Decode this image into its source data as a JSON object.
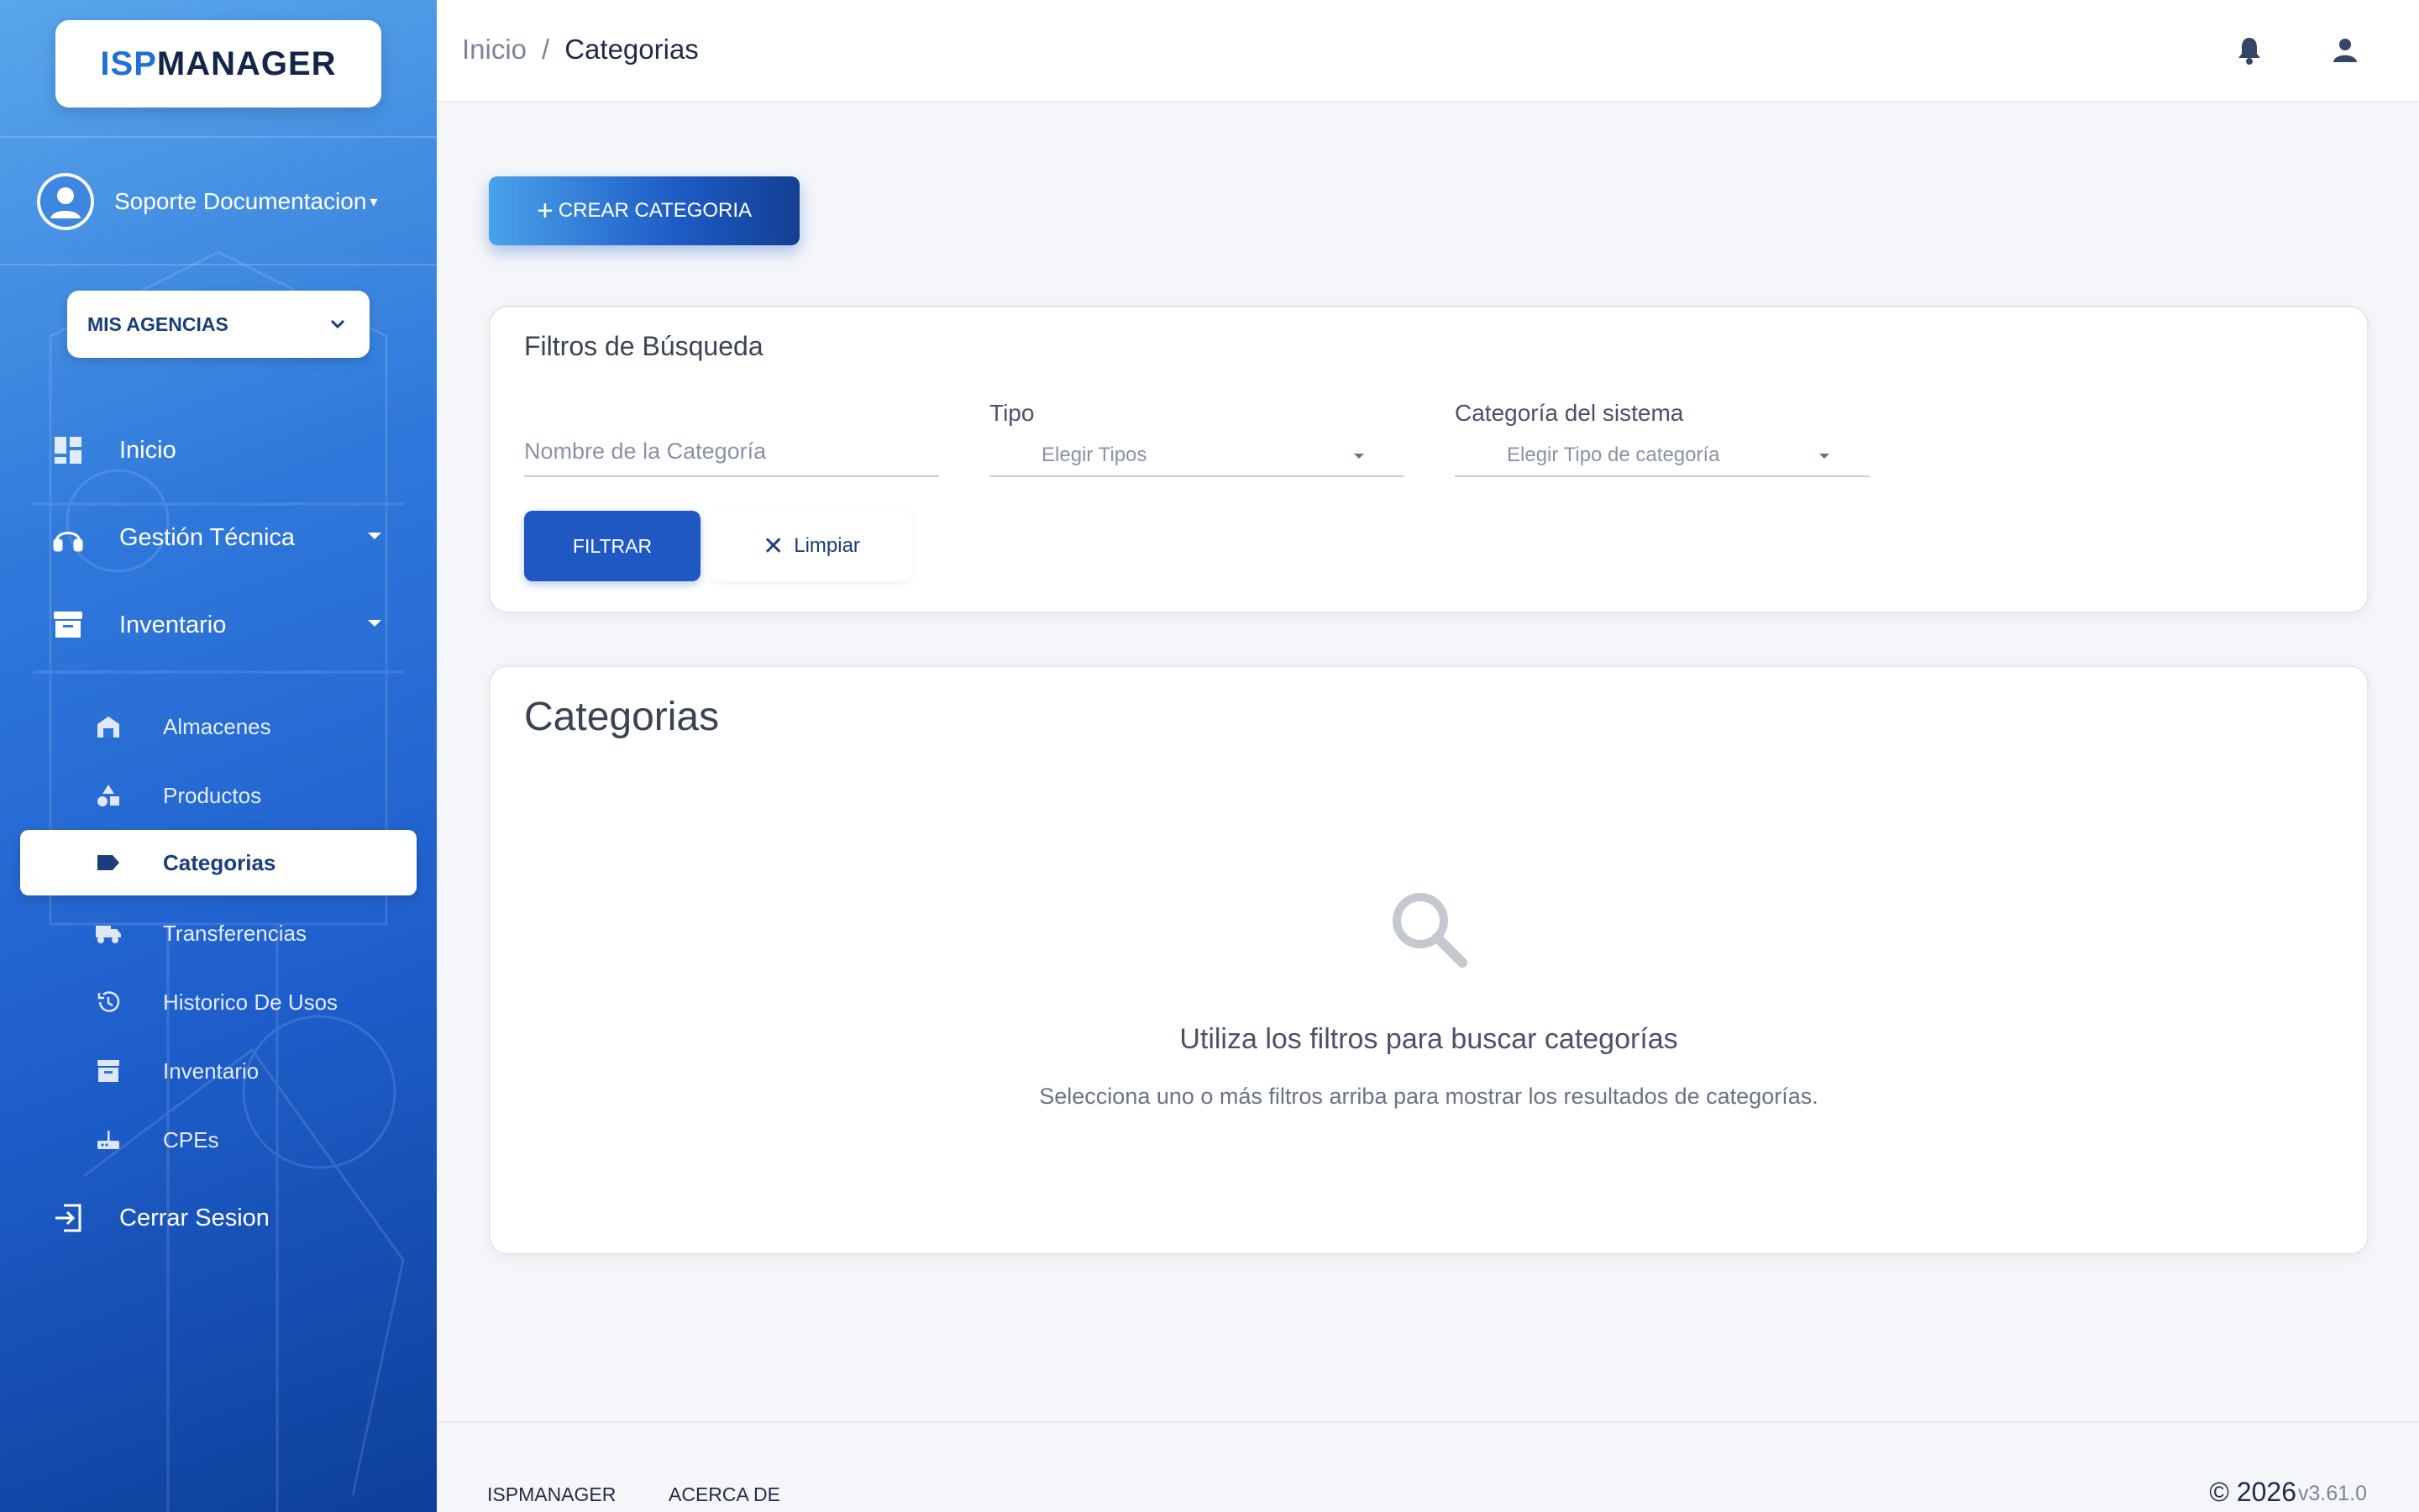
{
  "app": {
    "logo_part1": "ISP",
    "logo_part2": "MANAGER"
  },
  "sidebar": {
    "user_name": "Soporte Documentacion",
    "agency_label": "MIS AGENCIAS",
    "nav": [
      {
        "label": "Inicio",
        "icon": "dashboard-icon"
      },
      {
        "label": "Gestión Técnica",
        "icon": "headset-icon"
      },
      {
        "label": "Inventario",
        "icon": "archive-icon"
      }
    ],
    "sub_items": [
      {
        "label": "Almacenes",
        "icon": "warehouse-icon"
      },
      {
        "label": "Productos",
        "icon": "shapes-icon"
      },
      {
        "label": "Categorias",
        "icon": "label-icon"
      },
      {
        "label": "Transferencias",
        "icon": "truck-icon"
      },
      {
        "label": "Historico De Usos",
        "icon": "history-icon"
      },
      {
        "label": "Inventario",
        "icon": "archive-icon"
      },
      {
        "label": "CPEs",
        "icon": "router-icon"
      }
    ],
    "logout_label": "Cerrar Sesion"
  },
  "topbar": {
    "breadcrumb_home": "Inicio",
    "breadcrumb_sep": "/",
    "breadcrumb_current": "Categorias"
  },
  "main": {
    "create_button": "CREAR CATEGORIA",
    "filters": {
      "title": "Filtros de Búsqueda",
      "name_placeholder": "Nombre de la Categoría",
      "tipo_label": "Tipo",
      "tipo_value": "Elegir Tipos",
      "sistema_label": "Categoría del sistema",
      "sistema_value": "Elegir Tipo de categoría",
      "filter_button": "FILTRAR",
      "clear_button": "Limpiar"
    },
    "results": {
      "title": "Categorias",
      "empty_title": "Utiliza los filtros para buscar categorías",
      "empty_subtitle": "Selecciona uno o más filtros arriba para mostrar los resultados de categorías."
    }
  },
  "footer": {
    "link1": "ISPMANAGER",
    "link2": "ACERCA DE",
    "copyright": "© 2026",
    "version": "v3.61.0"
  },
  "colors": {
    "primary": "#1f57c3",
    "sidebar_top": "#5aa6ea",
    "sidebar_bottom": "#0d3f9a",
    "background": "#f4f6f9"
  }
}
